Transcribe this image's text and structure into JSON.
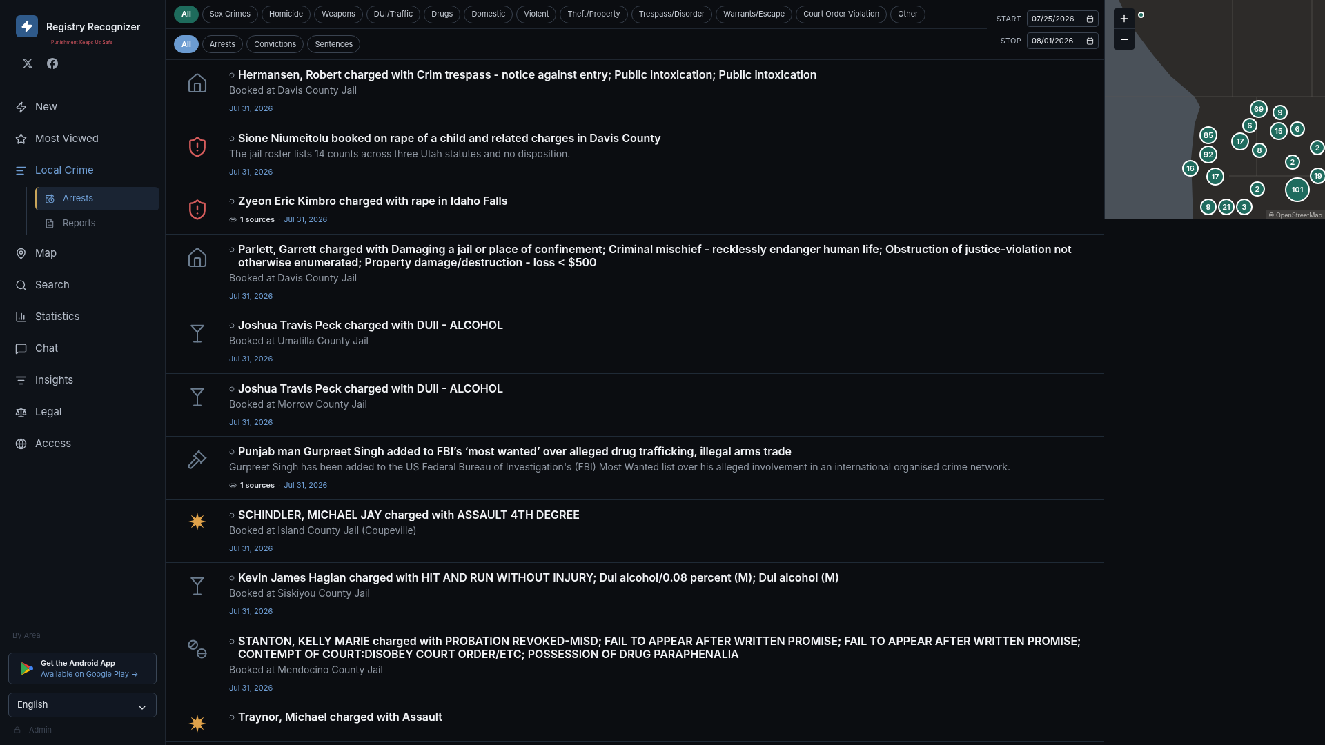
{
  "brand": {
    "name": "Registry Recognizer",
    "tagline": "Punishment Keeps Us Safe"
  },
  "sidebar": {
    "items": [
      {
        "label": "New",
        "kind": "new",
        "selected": false
      },
      {
        "label": "Most Viewed",
        "kind": "most_viewed",
        "selected": false
      },
      {
        "label": "Local Crime",
        "kind": "local",
        "selected": true,
        "expanded": true,
        "children": [
          {
            "label": "Arrests",
            "kind": "arrests",
            "selected": true
          },
          {
            "label": "Reports",
            "kind": "reports",
            "selected": false
          }
        ]
      },
      {
        "label": "Map",
        "kind": "map",
        "selected": false
      },
      {
        "label": "Search",
        "kind": "search",
        "selected": false
      },
      {
        "label": "Statistics",
        "kind": "statistics",
        "selected": false
      },
      {
        "label": "Chat",
        "kind": "chat",
        "selected": false
      },
      {
        "label": "Insights",
        "kind": "insights",
        "selected": false
      },
      {
        "label": "Legal",
        "kind": "legal",
        "selected": false
      },
      {
        "label": "Access",
        "kind": "access",
        "selected": false
      }
    ],
    "section_label": "By Area",
    "app_promo": {
      "title": "Get the Android App",
      "subtitle": "Available on Google Play →"
    },
    "language": {
      "value": "English"
    },
    "admin": "Admin"
  },
  "categories": [
    {
      "label": "All",
      "selected": true
    },
    {
      "label": "Sex Crimes",
      "selected": false
    },
    {
      "label": "Homicide",
      "selected": false
    },
    {
      "label": "Weapons",
      "selected": false
    },
    {
      "label": "DUI/Traffic",
      "selected": false
    },
    {
      "label": "Drugs",
      "selected": false
    },
    {
      "label": "Domestic",
      "selected": false
    },
    {
      "label": "Violent",
      "selected": false
    },
    {
      "label": "Theft/Property",
      "selected": false
    },
    {
      "label": "Trespass/Disorder",
      "selected": false
    },
    {
      "label": "Warrants/Escape",
      "selected": false
    },
    {
      "label": "Court Order Violation",
      "selected": false
    },
    {
      "label": "Other",
      "selected": false
    }
  ],
  "types": [
    {
      "label": "All",
      "selected": true
    },
    {
      "label": "Arrests",
      "selected": false
    },
    {
      "label": "Convictions",
      "selected": false
    },
    {
      "label": "Sentences",
      "selected": false
    }
  ],
  "dates": {
    "start_label": "START",
    "start": "07/25/2026",
    "stop_label": "STOP",
    "stop": "08/01/2026"
  },
  "items": [
    {
      "kind": "trespass",
      "title": "Hermansen, Robert charged with Crim trespass - notice against entry; Public intoxication; Public intoxication",
      "subtitle": "Booked at Davis County Jail",
      "date": "Jul 31, 2026"
    },
    {
      "kind": "sex_crime",
      "title": "Sione Niumeitolu booked on rape of a child and related charges in Davis County",
      "subtitle": "The jail roster lists 14 counts across three Utah statutes and no disposition.",
      "date": "Jul 31, 2026"
    },
    {
      "kind": "sex_crime",
      "title": "Zyeon Eric Kimbro charged with rape in Idaho Falls",
      "sources": "1 sources",
      "separator": "·",
      "date": "Jul 31, 2026"
    },
    {
      "kind": "trespass",
      "title": "Parlett, Garrett charged with Damaging a jail or place of confinement; Criminal mischief - recklessly endanger human life; Obstruction of justice-violation not otherwise enumerated; Property damage/destruction - loss < $500",
      "subtitle": "Booked at Davis County Jail",
      "date": "Jul 31, 2026"
    },
    {
      "kind": "dui",
      "title": "Joshua Travis Peck charged with DUII - ALCOHOL",
      "subtitle": "Booked at Umatilla County Jail",
      "date": "Jul 31, 2026"
    },
    {
      "kind": "dui",
      "title": "Joshua Travis Peck charged with DUII - ALCOHOL",
      "subtitle": "Booked at Morrow County Jail",
      "date": "Jul 31, 2026"
    },
    {
      "kind": "court",
      "title": "Punjab man Gurpreet Singh added to FBI’s ‘most wanted’ over alleged drug trafficking, illegal arms trade",
      "subtitle": "Gurpreet Singh has been added to the US Federal Bureau of Investigation's (FBI) Most Wanted list over his alleged involvement in an international organised crime network.",
      "sources": "1 sources",
      "separator": "·",
      "date": "Jul 31, 2026"
    },
    {
      "kind": "violent",
      "title": "SCHINDLER, MICHAEL JAY charged with ASSAULT 4TH DEGREE",
      "subtitle": "Booked at Island County Jail (Coupeville)",
      "date": "Jul 31, 2026"
    },
    {
      "kind": "dui",
      "title": "Kevin James Haglan charged with HIT AND RUN WITHOUT INJURY; Dui alcohol/0.08 percent (M); Dui alcohol (M)",
      "subtitle": "Booked at Siskiyou County Jail",
      "date": "Jul 31, 2026"
    },
    {
      "kind": "drugs",
      "title": "STANTON, KELLY MARIE charged with PROBATION REVOKED-MISD; FAIL TO APPEAR AFTER WRITTEN PROMISE; FAIL TO APPEAR AFTER WRITTEN PROMISE; CONTEMPT OF COURT:DISOBEY COURT ORDER/ETC; POSSESSION OF DRUG PARAPHENALIA",
      "subtitle": "Booked at Mendocino County Jail",
      "date": "Jul 31, 2026"
    },
    {
      "kind": "violent",
      "title": "Traynor, Michael charged with Assault"
    }
  ],
  "map": {
    "clusters": [
      "69",
      "9",
      "6",
      "15",
      "6",
      "17",
      "8",
      "2",
      "2",
      "101",
      "19",
      "2",
      "85",
      "92",
      "16",
      "17",
      "9",
      "21",
      "3"
    ],
    "attribution": "© OpenStreetMap"
  }
}
